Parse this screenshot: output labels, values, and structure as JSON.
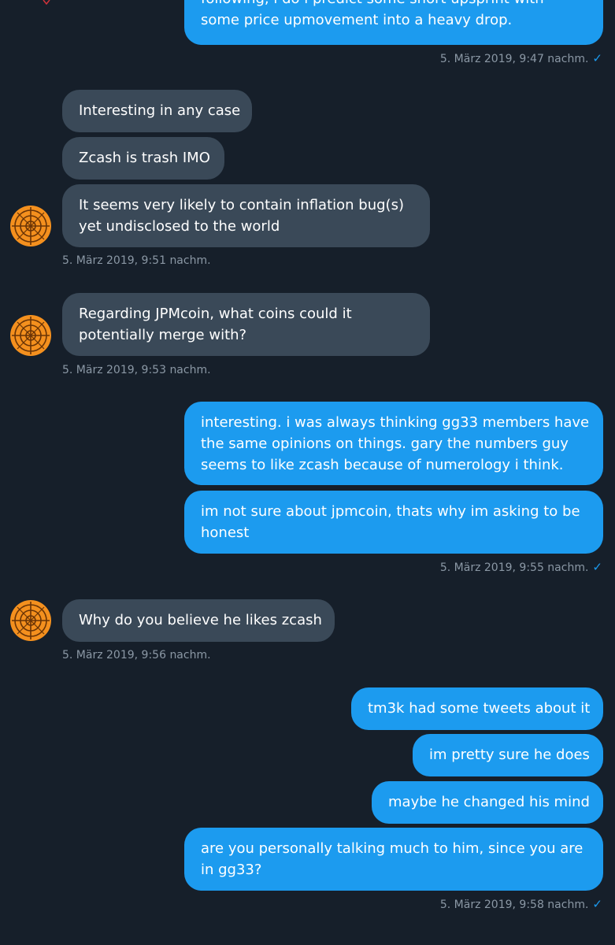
{
  "conversation": {
    "messages": {
      "m0": {
        "line1": "following, i do l predict some short upsprint with",
        "line2": "some price upmovement into a heavy drop."
      },
      "m1": {
        "line1": "Interesting in any case"
      },
      "m2": {
        "line1": "Zcash is trash IMO"
      },
      "m3": {
        "line1": "It seems very likely to contain inflation bug(s)",
        "line2": "yet undisclosed to the world"
      },
      "m4": {
        "line1": "Regarding JPMcoin, what coins could it",
        "line2": "potentially merge with?"
      },
      "m5": {
        "line1": "interesting. i was always thinking gg33 members have",
        "line2": "the same opinions on things. gary the numbers guy",
        "line3": "seems to like zcash because of numerology i think."
      },
      "m6": {
        "line1": "im not sure about jpmcoin, thats why im asking to be",
        "line2": "honest"
      },
      "m7": {
        "line1": "Why do you believe he likes zcash"
      },
      "m8": {
        "line1": "tm3k had some tweets about it"
      },
      "m9": {
        "line1": "im pretty sure he does"
      },
      "m10": {
        "line1": "maybe he changed his mind"
      },
      "m11": {
        "line1": "are you personally talking much to him, since you are",
        "line2": "in gg33?"
      }
    },
    "timestamps": {
      "t0": "5. März 2019, 9:47 nachm.",
      "t1": "5. März 2019, 9:51 nachm.",
      "t2": "5. März 2019, 9:53 nachm.",
      "t3": "5. März 2019, 9:55 nachm.",
      "t4": "5. März 2019, 9:56 nachm.",
      "t5": "5. März 2019, 9:58 nachm."
    },
    "read_check": "✓"
  },
  "icons": {
    "avatar": "target-avatar-icon",
    "read": "checkmark-icon"
  },
  "colors": {
    "background": "#161f2a",
    "sent_bubble": "#1c9bef",
    "received_bubble": "#3a4958",
    "timestamp": "#8b98a5",
    "avatar": "#f4901e"
  }
}
